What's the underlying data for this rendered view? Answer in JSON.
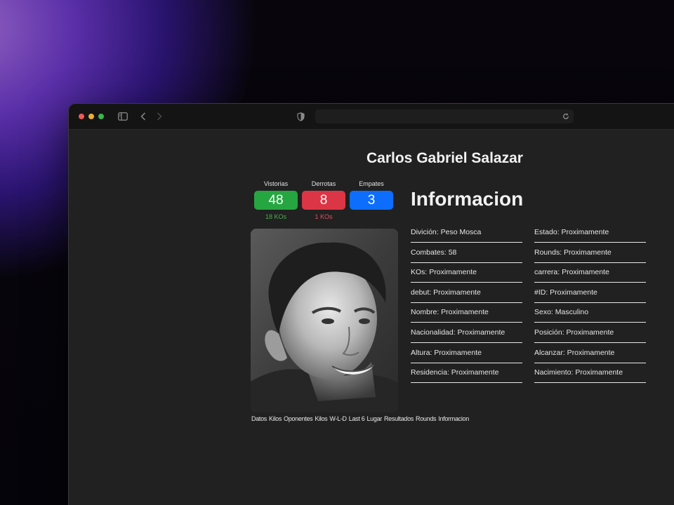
{
  "fighter": {
    "name": "Carlos Gabriel Salazar"
  },
  "record": {
    "wins": {
      "label": "Vistorias",
      "value": "48",
      "sub": "18 KOs",
      "color": "#26a641",
      "sub_color": "#4caf50"
    },
    "losses": {
      "label": "Derrotas",
      "value": "8",
      "sub": "1 KOs",
      "color": "#dc3545",
      "sub_color": "#e05060"
    },
    "draws": {
      "label": "Empates",
      "value": "3",
      "sub": "",
      "color": "#0d6efd"
    }
  },
  "info": {
    "title": "Informacion",
    "left": [
      "Divición: Peso Mosca",
      "Combates: 58",
      "KOs: Proximamente",
      "debut: Proximamente",
      "Nombre: Proximamente",
      "Nacionalidad: Proximamente",
      "Altura: Proximamente",
      "Residencia: Proximamente"
    ],
    "right": [
      "Estado: Proximamente",
      "Rounds: Proximamente",
      "carrera: Proximamente",
      "#ID: Proximamente",
      "Sexo: Masculino",
      "Posición: Proximamente",
      "Alcanzar: Proximamente",
      "Nacimiento: Proximamente"
    ]
  },
  "tabs": [
    "Datos",
    "Kilos",
    "Oponentes",
    "Kilos",
    "W-L-D",
    "Last 6",
    "Lugar",
    "Resultados",
    "Rounds",
    "Informacion"
  ],
  "browser": {
    "icons": [
      "sidebar-icon",
      "back-icon",
      "forward-icon",
      "shield-icon",
      "reload-icon"
    ]
  }
}
